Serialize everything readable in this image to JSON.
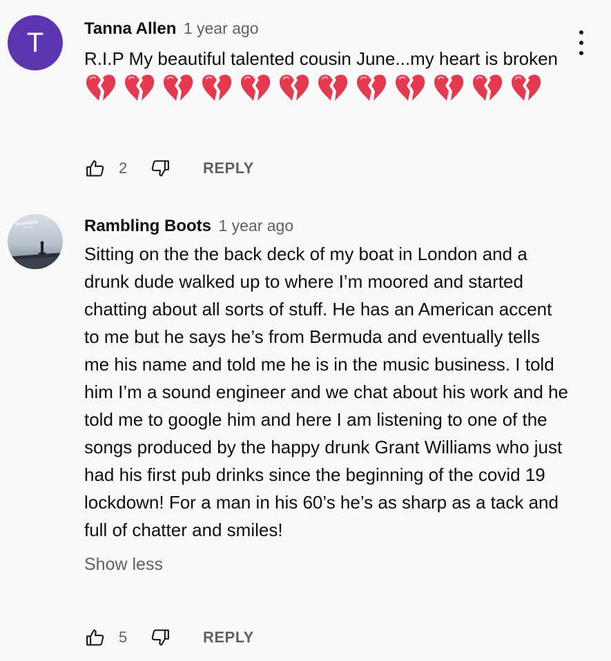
{
  "comments": [
    {
      "avatar_letter": "T",
      "avatar_color": "#5e35b1",
      "author": "Tanna Allen",
      "timestamp": "1 year ago",
      "text": "R.I.P My beautiful talented cousin June...my heart is broken",
      "emoji_icon": "broken-heart-icon",
      "emoji_count": 12,
      "likes": "2",
      "reply_label": "REPLY"
    },
    {
      "avatar_image": "Rambling Boots",
      "author": "Rambling Boots",
      "timestamp": "1 year ago",
      "text": "Sitting on the the back deck of my boat in London and a drunk dude walked up to where I’m moored and started chatting about all sorts of stuff. He has an American accent to me but he says he’s from Bermuda and eventually tells me his name and told me he is in the music business. I told him I’m a sound engineer and we chat about his work and he told me to google him and here I am listening to one of the songs produced by the happy drunk Grant Williams who just had his first pub drinks since the beginning of the covid 19 lockdown! For a man in his 60’s he’s as sharp as a tack and full of chatter and smiles!",
      "show_less_label": "Show less",
      "likes": "5",
      "reply_label": "REPLY"
    }
  ],
  "colors": {
    "background": "#f9f9f9",
    "text": "#0f0f0f",
    "secondary": "#606060",
    "heart": "#e53950"
  }
}
